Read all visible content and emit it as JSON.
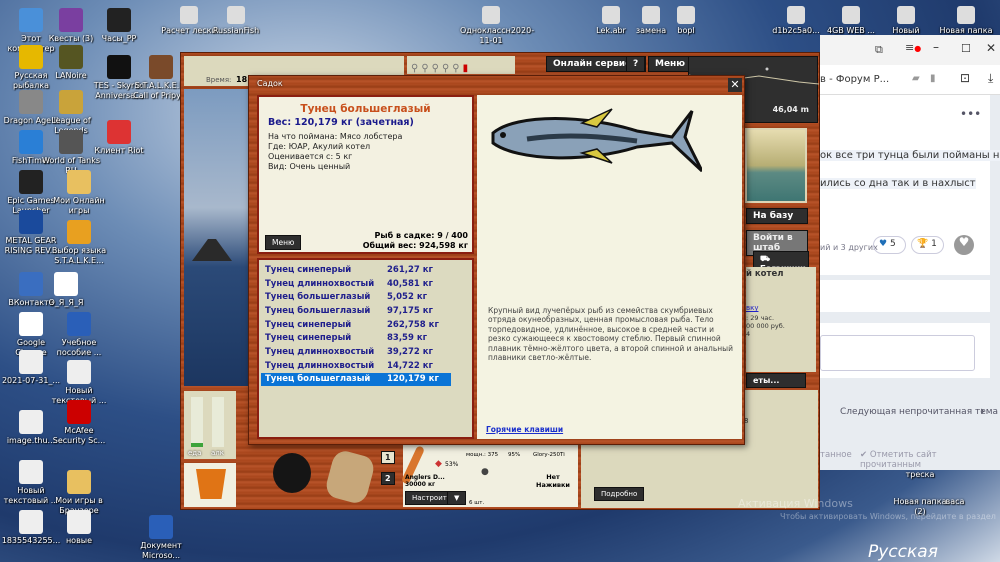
{
  "desktop": {
    "icons_left": [
      "Этот компьютер",
      "Квесты (3)",
      "Часы_PP",
      "Русская рыбалка",
      "LANoire",
      "TES - Skyrim Anniversa...",
      "S.T.A.L.K.E.R. Call of Pripyat",
      "Dragon Age II",
      "League of Legends",
      "FishTimer",
      "World of Tanks RU",
      "Клиент Riot",
      "Epic Games Launcher",
      "Мои Онлайн игры",
      "METAL GEAR RISING REV...",
      "Выбор языка S.T.A.L.K.E...",
      "ВКонтакте",
      "О_Я_Я_Я",
      "Google Chrome",
      "Учебное пособие ...",
      "2021-07-31_...",
      "Новый текстовый ...",
      "image.thu...",
      "McAfee Security Sc...",
      "Новый текстовый ...",
      "Мои игры в Браузере",
      "1835543255...",
      "новые",
      "Документ Microso..."
    ],
    "icons_top": [
      "Расчет лески",
      "RussianFish",
      "Одноклассн2020-11-01",
      "Lek.abr",
      "замена",
      "bopl",
      "d1b2c5a0...",
      "4GB WEB ...",
      "Новый",
      "Новая папка"
    ],
    "icons_right": [
      "треска",
      "Новая папка (2)",
      "васа"
    ],
    "activation": "Активация Windows",
    "activation_sub": "Чтобы активировать Windows, перейдите в раздел",
    "wallpaper_text": "Русская"
  },
  "browser": {
    "tab_title": "в - Форум Р...",
    "post_line1": "ок все три тунца были пойманы на",
    "post_line2": "ились со дна так и в нахлыст",
    "reactions_text": "ий и 3 других",
    "likes": "5",
    "trophies": "1",
    "next_topic": "Следующая непрочитанная тема",
    "mark_read_partial": "танное",
    "mark_site_read": "Отметить сайт прочитанным"
  },
  "game": {
    "time_label": "Время:",
    "time_value": "18:1",
    "online_services": "Онлайн сервисы",
    "help": "?",
    "menu": "Меню",
    "depth": "46,04 m",
    "to_base": "На базу",
    "enter_hq": "Войти в штаб",
    "trunk": "Багажник",
    "location_partial": "й котел",
    "link_partial": "вку",
    "info1": ": 29 час.",
    "info2": "00 000 руб.",
    "info3": "4",
    "tickets_partial": "еты...",
    "num_partial": "8",
    "food_label": "еда",
    "alc_label": "алк",
    "food_level": 0.08,
    "alc_level": 0,
    "slot1": "1",
    "slot2": "2",
    "rod_name": "Anglers D...",
    "rod_weight": "30000 кг",
    "float_pct": "53%",
    "reel_power": "мощн.: 375",
    "reel_pct": "95%",
    "line_name": "Glory-250Ti",
    "hooks": "6 шт.",
    "no_bait": "Нет Наживки",
    "configure": "Настроить",
    "details": "Подробно"
  },
  "dialog": {
    "title": "Садок",
    "fish_name": "Тунец большеглазый",
    "weight": "Вес: 120,179 кг (зачетная)",
    "bait": "На что поймана: Мясо лобстера",
    "where": "Где: ЮАР, Акулий котел",
    "valued_from": "Оценивается с: 5 кг",
    "kind": "Вид: Очень ценный",
    "menu": "Меню",
    "count": "Рыб в садке: 9 / 400",
    "total": "Общий вес: 924,598 кг",
    "fish_list": [
      {
        "name": "Тунец синеперый",
        "weight": "261,27 кг"
      },
      {
        "name": "Тунец длиннохвостый",
        "weight": "40,581 кг"
      },
      {
        "name": "Тунец большеглазый",
        "weight": "5,052 кг"
      },
      {
        "name": "Тунец большеглазый",
        "weight": "97,175 кг"
      },
      {
        "name": "Тунец синеперый",
        "weight": "262,758 кг"
      },
      {
        "name": "Тунец синеперый",
        "weight": "83,59 кг"
      },
      {
        "name": "Тунец длиннохвостый",
        "weight": "39,272 кг"
      },
      {
        "name": "Тунец длиннохвостый",
        "weight": "14,722 кг"
      },
      {
        "name": "Тунец большеглазый",
        "weight": "120,179 кг",
        "selected": true
      }
    ],
    "description": "Крупный вид лучепёрых рыб из семейства скумбриевых отряда окунеобразных, ценная промысловая рыба. Тело торпедовидное, удлинённое, высокое в средней части и резко сужающееся к хвостовому стеблю. Первый спинной плавник тёмно-жёлтого цвета, а второй спинной и анальный плавники светло-жёлтые.",
    "hotkeys": "Горячие клавиши"
  }
}
